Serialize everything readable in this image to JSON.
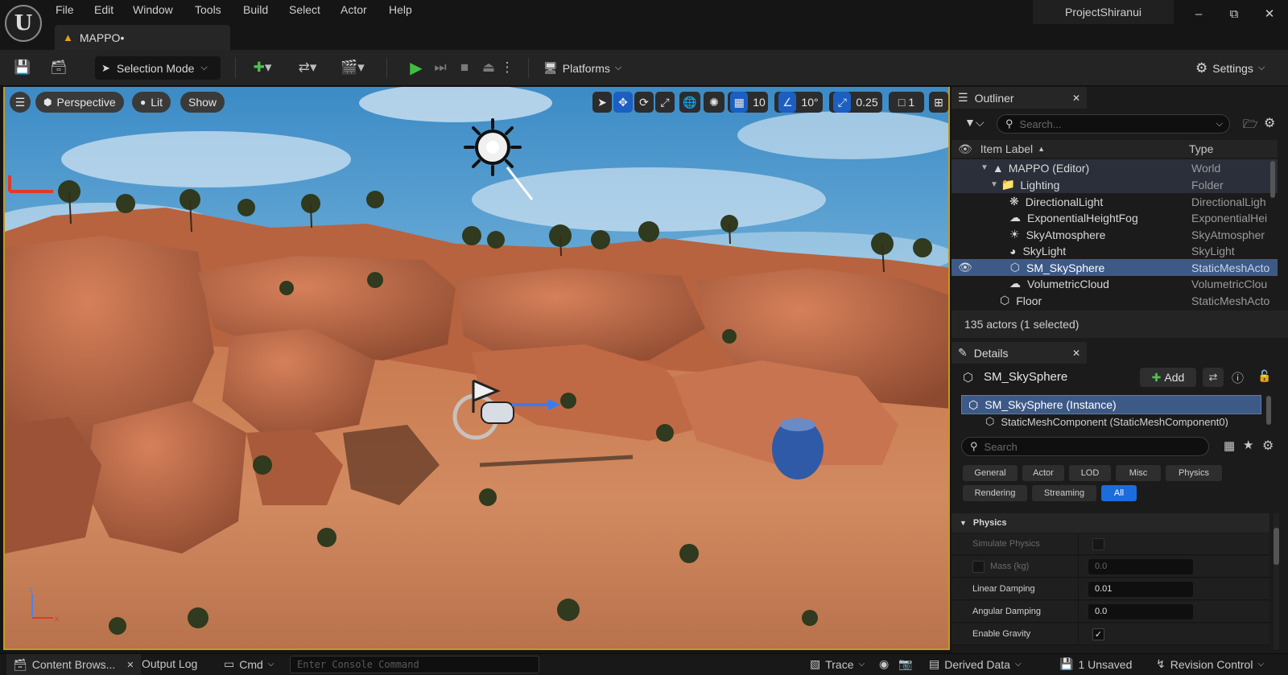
{
  "app": {
    "project": "ProjectShiranui",
    "map_tab": "MAPPO•",
    "menu": [
      "File",
      "Edit",
      "Window",
      "Tools",
      "Build",
      "Select",
      "Actor",
      "Help"
    ]
  },
  "toolbar": {
    "selection_mode": "Selection Mode",
    "platforms": "Platforms",
    "settings": "Settings"
  },
  "viewport": {
    "perspective": "Perspective",
    "lit": "Lit",
    "show": "Show",
    "grid_snap": "10",
    "rot_snap": "10°",
    "scale_snap": "0.25",
    "camera_speed": "1"
  },
  "outliner": {
    "tab_label": "Outliner",
    "search_placeholder": "Search...",
    "col_label": "Item Label",
    "col_type": "Type",
    "rows": [
      {
        "label": "MAPPO (Editor)",
        "type": "World"
      },
      {
        "label": "Lighting",
        "type": "Folder"
      },
      {
        "label": "DirectionalLight",
        "type": "DirectionalLigh"
      },
      {
        "label": "ExponentialHeightFog",
        "type": "ExponentialHei"
      },
      {
        "label": "SkyAtmosphere",
        "type": "SkyAtmospher"
      },
      {
        "label": "SkyLight",
        "type": "SkyLight"
      },
      {
        "label": "SM_SkySphere",
        "type": "StaticMeshActo"
      },
      {
        "label": "VolumetricCloud",
        "type": "VolumetricClou"
      },
      {
        "label": "Floor",
        "type": "StaticMeshActo"
      }
    ],
    "status": "135 actors (1 selected)"
  },
  "details": {
    "tab_label": "Details",
    "object_name": "SM_SkySphere",
    "add_label": "Add",
    "instance": "SM_SkySphere (Instance)",
    "component": "StaticMeshComponent (StaticMeshComponent0)",
    "search_placeholder": "Search",
    "filters": [
      "General",
      "Actor",
      "LOD",
      "Misc",
      "Physics",
      "Rendering",
      "Streaming",
      "All"
    ],
    "section": "Physics",
    "props": {
      "simulate_physics": "Simulate Physics",
      "mass": "Mass (kg)",
      "mass_value": "0.0",
      "linear_damping": "Linear Damping",
      "linear_damping_value": "0.01",
      "angular_damping": "Angular Damping",
      "angular_damping_value": "0.0",
      "enable_gravity": "Enable Gravity"
    }
  },
  "bottom": {
    "content_browser": "Content Brows...",
    "output_log": "Output Log",
    "cmd": "Cmd",
    "console_placeholder": "Enter Console Command",
    "trace": "Trace",
    "derived_data": "Derived Data",
    "unsaved": "1 Unsaved",
    "revision_control": "Revision Control"
  },
  "colors": {
    "accent": "#1b6cdc",
    "selection": "#3d5a87",
    "viewport_border": "#c49a1a",
    "play_green": "#3fbf3f"
  }
}
